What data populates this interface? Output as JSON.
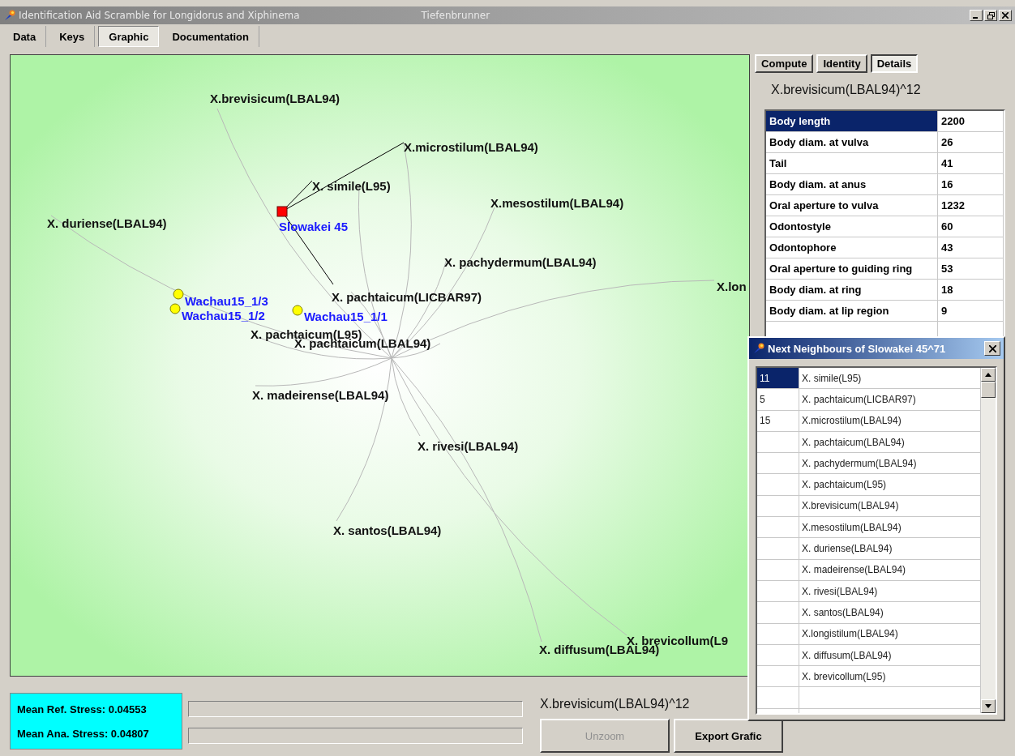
{
  "window": {
    "title": "Identification Aid Scramble for Longidorus and Xiphinema",
    "author": "Tiefenbrunner"
  },
  "menu_tabs": [
    {
      "label": "Data",
      "selected": false
    },
    {
      "label": "Keys",
      "selected": false
    },
    {
      "label": "Graphic",
      "selected": true
    },
    {
      "label": "Documentation",
      "selected": false
    }
  ],
  "graph": {
    "species": [
      {
        "name": "X.brevisicum(LBAL94)"
      },
      {
        "name": "X.microstilum(LBAL94)"
      },
      {
        "name": "X. simile(L95)"
      },
      {
        "name": "X.mesostilum(LBAL94)"
      },
      {
        "name": "X. duriense(LBAL94)"
      },
      {
        "name": "X. pachydermum(LBAL94)"
      },
      {
        "name": "X.lon"
      },
      {
        "name": "X. pachtaicum(LICBAR97)"
      },
      {
        "name": "X. pachtaicum(L95)"
      },
      {
        "name": "X. pachtaicum(LBAL94)"
      },
      {
        "name": "X. madeirense(LBAL94)"
      },
      {
        "name": "X. rivesi(LBAL94)"
      },
      {
        "name": "X. santos(LBAL94)"
      },
      {
        "name": "X. brevicollum(L9"
      },
      {
        "name": "X. diffusum(LBAL94)"
      }
    ],
    "samples": [
      {
        "name": "Slowakei 45",
        "selected": true
      },
      {
        "name": "Wachau15_1/3",
        "selected": false
      },
      {
        "name": "Wachau15_1/2",
        "selected": false
      },
      {
        "name": "Wachau15_1/1",
        "selected": false
      }
    ]
  },
  "side_tabs": [
    {
      "label": "Compute",
      "selected": false
    },
    {
      "label": "Identity",
      "selected": false
    },
    {
      "label": "Details",
      "selected": true
    }
  ],
  "details": {
    "title": "X.brevisicum(LBAL94)^12",
    "rows": [
      {
        "name": "Body length",
        "value": "2200",
        "selected": true
      },
      {
        "name": "Body diam. at vulva",
        "value": "26",
        "selected": false
      },
      {
        "name": "Tail",
        "value": "41",
        "selected": false
      },
      {
        "name": "Body diam. at anus",
        "value": "16",
        "selected": false
      },
      {
        "name": "Oral aperture to vulva",
        "value": "1232",
        "selected": false
      },
      {
        "name": "Odontostyle",
        "value": "60",
        "selected": false
      },
      {
        "name": "Odontophore",
        "value": "43",
        "selected": false
      },
      {
        "name": "Oral aperture to guiding ring",
        "value": "53",
        "selected": false
      },
      {
        "name": "Body diam. at ring",
        "value": "18",
        "selected": false
      },
      {
        "name": "Body diam. at lip region",
        "value": "9",
        "selected": false
      }
    ]
  },
  "neighbours": {
    "title": "Next Neighbours of Slowakei 45^71",
    "rows": [
      {
        "rank": "11",
        "name": "X. simile(L95)",
        "selected": true
      },
      {
        "rank": "5",
        "name": "X. pachtaicum(LICBAR97)",
        "selected": false
      },
      {
        "rank": "15",
        "name": "X.microstilum(LBAL94)",
        "selected": false
      },
      {
        "name": "X. pachtaicum(LBAL94)",
        "selected": false
      },
      {
        "name": "X. pachydermum(LBAL94)",
        "selected": false
      },
      {
        "name": "X. pachtaicum(L95)",
        "selected": false
      },
      {
        "name": "X.brevisicum(LBAL94)",
        "selected": false
      },
      {
        "name": "X.mesostilum(LBAL94)",
        "selected": false
      },
      {
        "name": "X. duriense(LBAL94)",
        "selected": false
      },
      {
        "name": "X. madeirense(LBAL94)",
        "selected": false
      },
      {
        "name": "X. rivesi(LBAL94)",
        "selected": false
      },
      {
        "name": "X. santos(LBAL94)",
        "selected": false
      },
      {
        "name": "X.longistilum(LBAL94)",
        "selected": false
      },
      {
        "name": "X. diffusum(LBAL94)",
        "selected": false
      },
      {
        "name": "X. brevicollum(L95)",
        "selected": false
      }
    ]
  },
  "stress": [
    "Mean Ref. Stress: 0.04553",
    "Mean Ana. Stress: 0.04807"
  ],
  "progress": [
    {
      "level": 0
    },
    {
      "level": 0
    }
  ],
  "current": "X.brevisicum(LBAL94)^12",
  "buttons": [
    {
      "label": "Unzoom",
      "disabled": true
    },
    {
      "label": "Export Grafic",
      "disabled": false
    }
  ]
}
